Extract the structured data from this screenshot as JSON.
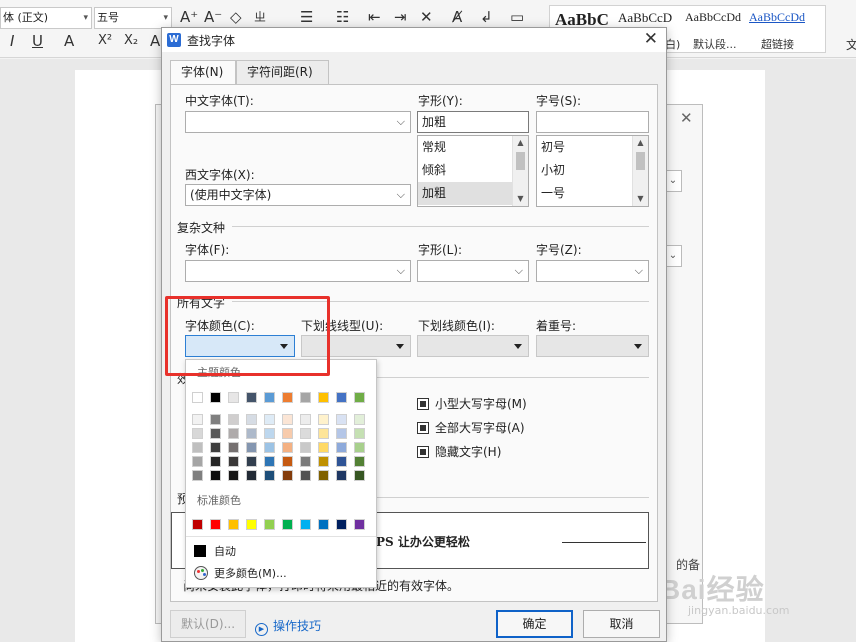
{
  "background": {
    "ribbon": {
      "font_name": "体 (正文)",
      "font_size": "五号",
      "styles": [
        "AaBbC",
        "AaBbCcD",
        "AaBbCcDd",
        "AaBbCcDd"
      ],
      "style_labels": [
        "白)",
        "默认段...",
        "超链接"
      ],
      "right_label": "文"
    },
    "doc_fragment": "的备",
    "watermark": "Bai经验",
    "watermark_sub": "jingyan.baidu.com"
  },
  "dialog": {
    "title": "查找字体",
    "app_icon": "W",
    "close_icon": "close-icon",
    "tabs": [
      {
        "label": "字体(N)",
        "active": true
      },
      {
        "label": "字符间距(R)",
        "active": false
      }
    ],
    "labels": {
      "chinese_font": "中文字体(T):",
      "style": "字形(Y):",
      "size": "字号(S):",
      "western_font": "西文字体(X):",
      "complex_section": "复杂文种",
      "complex_font": "字体(F):",
      "complex_style": "字形(L):",
      "complex_size": "字号(Z):",
      "all_text_section": "所有文字",
      "font_color": "字体颜色(C):",
      "underline_type": "下划线线型(U):",
      "underline_color": "下划线颜色(I):",
      "emphasis": "着重号:",
      "effects_section": "效果",
      "preview_section": "预览"
    },
    "fields": {
      "chinese_font_value": "",
      "style_value": "加粗",
      "size_value": "",
      "western_font_value": "(使用中文字体)",
      "complex_font_value": "",
      "complex_style_value": "",
      "complex_size_value": "",
      "font_color_value": "",
      "underline_type_value": "",
      "underline_color_value": "",
      "emphasis_value": ""
    },
    "style_list": [
      {
        "label": "常规",
        "selected": false
      },
      {
        "label": "倾斜",
        "selected": false
      },
      {
        "label": "加粗",
        "selected": true
      }
    ],
    "size_list": [
      {
        "label": "初号",
        "selected": false
      },
      {
        "label": "小初",
        "selected": false
      },
      {
        "label": "一号",
        "selected": false
      }
    ],
    "effects": [
      {
        "label": "小型大写字母(M)",
        "checked": true
      },
      {
        "label": "全部大写字母(A)",
        "checked": true
      },
      {
        "label": "隐藏文字(H)",
        "checked": true
      }
    ],
    "preview_text": "PS 让办公更轻松",
    "footnote": "尚未安装此字体，打印时将采用最相近的有效字体。",
    "buttons": {
      "default": "默认(D)...",
      "tips": "操作技巧",
      "ok": "确定",
      "cancel": "取消"
    }
  },
  "color_popup": {
    "theme_header": "主题颜色",
    "standard_header": "标准颜色",
    "auto_label": "自动",
    "more_label": "更多颜色(M)...",
    "theme_colors": [
      "#FFFFFF",
      "#000000",
      "#E7E6E6",
      "#44546A",
      "#5B9BD5",
      "#ED7D31",
      "#A5A5A5",
      "#FFC000",
      "#4472C4",
      "#70AD47"
    ],
    "theme_shades": [
      [
        "#F2F2F2",
        "#7F7F7F",
        "#D0CECE",
        "#D6DCE4",
        "#DEEBF6",
        "#FBE5D5",
        "#EDEDED",
        "#FFF2CC",
        "#D9E2F3",
        "#E2EFD9"
      ],
      [
        "#D8D8D8",
        "#595959",
        "#AEAAAA",
        "#ADB9CA",
        "#BDD7EE",
        "#F7CBAC",
        "#DBDBDB",
        "#FEE599",
        "#B4C6E7",
        "#C5E0B3"
      ],
      [
        "#BFBFBF",
        "#3F3F3F",
        "#757070",
        "#8496B0",
        "#9CC3E5",
        "#F4B183",
        "#C9C9C9",
        "#FFD965",
        "#8EAADB",
        "#A8D08D"
      ],
      [
        "#A5A5A5",
        "#262626",
        "#3A3838",
        "#323F4F",
        "#2E75B5",
        "#C55A11",
        "#7B7B7B",
        "#BF9000",
        "#2F5496",
        "#538135"
      ],
      [
        "#7F7F7F",
        "#0C0C0C",
        "#171616",
        "#222A35",
        "#1E4E79",
        "#833C0B",
        "#525252",
        "#7F6000",
        "#1F3864",
        "#375623"
      ]
    ],
    "standard_colors": [
      "#C00000",
      "#FF0000",
      "#FFC000",
      "#FFFF00",
      "#92D050",
      "#00B050",
      "#00B0F0",
      "#0070C0",
      "#002060",
      "#7030A0"
    ],
    "auto_color": "#000000",
    "highlight_color": "#E8312B"
  }
}
